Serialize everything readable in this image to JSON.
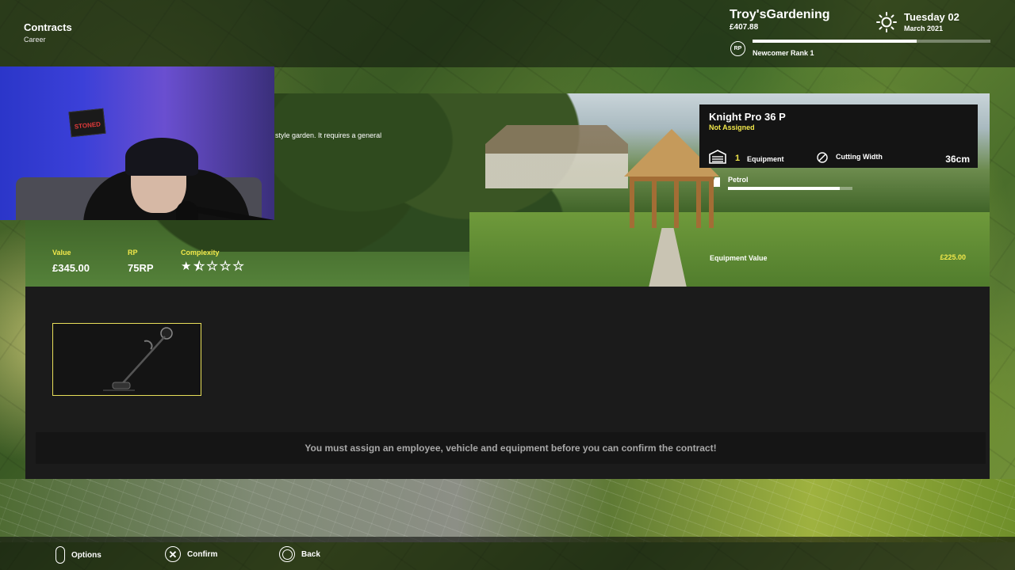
{
  "header": {
    "title": "Contracts",
    "subtitle": "Career",
    "farm_name": "Troy'sGardening",
    "money": "£407.88",
    "rp_badge": "RP",
    "rank": "Newcomer Rank 1",
    "rank_progress": 0.69,
    "date_day": "Tuesday 02",
    "date_month": "March 2021",
    "weather_icon": "sun-icon"
  },
  "contract": {
    "description": "style garden. It requires a general",
    "value_label": "Value",
    "value": "£345.00",
    "rp_label": "RP",
    "rp_value": "75RP",
    "complexity_label": "Complexity",
    "complexity_rating": 1.5,
    "complexity_max": 5
  },
  "equipment": {
    "name": "Knight Pro 36 P",
    "status": "Not Assigned",
    "count": "1",
    "count_label": "Equipment",
    "cutting_label": "Cutting Width",
    "cutting_value": "36cm",
    "fuel_label": "Petrol",
    "fuel_level": 0.9,
    "value_label": "Equipment Value",
    "value": "£225.00",
    "slot_icon": "strimmer-icon"
  },
  "warning": "You must assign an employee, vehicle and equipment before you can confirm the contract!",
  "controls": {
    "options": "Options",
    "confirm": "Confirm",
    "back": "Back"
  },
  "webcam": {
    "sign_text": "STONED"
  },
  "colors": {
    "accent_yellow": "#f2e84b",
    "panel_bg": "#1b1b1b",
    "warning_text": "#a8a8a8"
  }
}
